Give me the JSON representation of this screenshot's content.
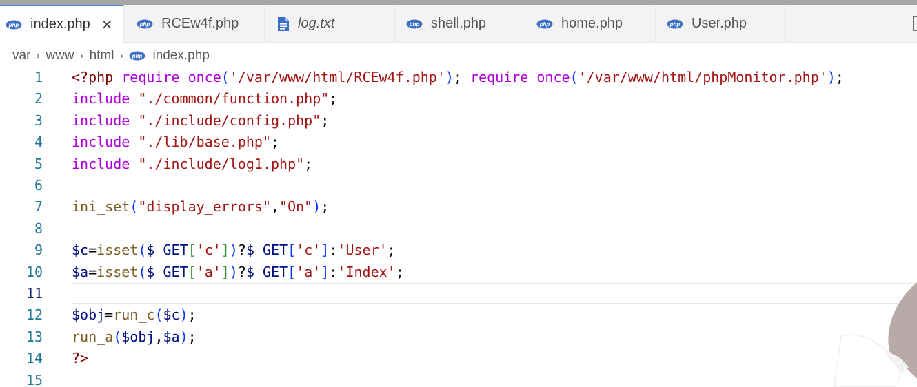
{
  "tabs": [
    {
      "label": "index.php",
      "icon": "php-icon",
      "active": true,
      "close": "✕"
    },
    {
      "label": "RCEw4f.php",
      "icon": "php-icon",
      "active": false
    },
    {
      "label": "log.txt",
      "icon": "file-text-icon",
      "active": false
    },
    {
      "label": "shell.php",
      "icon": "php-icon",
      "active": false
    },
    {
      "label": "home.php",
      "icon": "php-icon",
      "active": false
    },
    {
      "label": "User.php",
      "icon": "php-icon",
      "active": false
    }
  ],
  "breadcrumb": {
    "segments": [
      "var",
      "www",
      "html"
    ],
    "file": "index.php",
    "separator": "›"
  },
  "editor": {
    "active_line": 11,
    "lines": [
      {
        "n": "1",
        "tokens": [
          {
            "t": "<?php",
            "c": "tag"
          },
          {
            "t": " ",
            "c": "op"
          },
          {
            "t": "require_once",
            "c": "kw"
          },
          {
            "t": "(",
            "c": "p1"
          },
          {
            "t": "'/var/www/html/RCEw4f.php'",
            "c": "str"
          },
          {
            "t": ")",
            "c": "p1"
          },
          {
            "t": "; ",
            "c": "op"
          },
          {
            "t": "require_once",
            "c": "kw"
          },
          {
            "t": "(",
            "c": "p1"
          },
          {
            "t": "'/var/www/html/phpMonitor.php'",
            "c": "str"
          },
          {
            "t": ")",
            "c": "p1"
          },
          {
            "t": ";",
            "c": "op"
          }
        ]
      },
      {
        "n": "2",
        "tokens": [
          {
            "t": "include",
            "c": "kw"
          },
          {
            "t": " ",
            "c": "op"
          },
          {
            "t": "\"./common/function.php\"",
            "c": "str"
          },
          {
            "t": ";",
            "c": "op"
          }
        ]
      },
      {
        "n": "3",
        "tokens": [
          {
            "t": "include",
            "c": "kw"
          },
          {
            "t": " ",
            "c": "op"
          },
          {
            "t": "\"./include/config.php\"",
            "c": "str"
          },
          {
            "t": ";",
            "c": "op"
          }
        ]
      },
      {
        "n": "4",
        "tokens": [
          {
            "t": "include",
            "c": "kw"
          },
          {
            "t": " ",
            "c": "op"
          },
          {
            "t": "\"./lib/base.php\"",
            "c": "str"
          },
          {
            "t": ";",
            "c": "op"
          }
        ]
      },
      {
        "n": "5",
        "tokens": [
          {
            "t": "include",
            "c": "kw"
          },
          {
            "t": " ",
            "c": "op"
          },
          {
            "t": "\"./include/log1.php\"",
            "c": "str"
          },
          {
            "t": ";",
            "c": "op"
          }
        ]
      },
      {
        "n": "6",
        "tokens": []
      },
      {
        "n": "7",
        "tokens": [
          {
            "t": "ini_set",
            "c": "fn"
          },
          {
            "t": "(",
            "c": "p1"
          },
          {
            "t": "\"display_errors\"",
            "c": "str"
          },
          {
            "t": ",",
            "c": "op"
          },
          {
            "t": "\"On\"",
            "c": "str"
          },
          {
            "t": ")",
            "c": "p1"
          },
          {
            "t": ";",
            "c": "op"
          }
        ]
      },
      {
        "n": "8",
        "tokens": []
      },
      {
        "n": "9",
        "tokens": [
          {
            "t": "$c",
            "c": "var"
          },
          {
            "t": "=",
            "c": "op"
          },
          {
            "t": "isset",
            "c": "fn"
          },
          {
            "t": "(",
            "c": "p1"
          },
          {
            "t": "$_GET",
            "c": "var"
          },
          {
            "t": "[",
            "c": "p2"
          },
          {
            "t": "'c'",
            "c": "str"
          },
          {
            "t": "]",
            "c": "p2"
          },
          {
            "t": ")",
            "c": "p1"
          },
          {
            "t": "?",
            "c": "op"
          },
          {
            "t": "$_GET",
            "c": "var"
          },
          {
            "t": "[",
            "c": "p1"
          },
          {
            "t": "'c'",
            "c": "str"
          },
          {
            "t": "]",
            "c": "p1"
          },
          {
            "t": ":",
            "c": "op"
          },
          {
            "t": "'User'",
            "c": "str"
          },
          {
            "t": ";",
            "c": "op"
          }
        ]
      },
      {
        "n": "10",
        "tokens": [
          {
            "t": "$a",
            "c": "var"
          },
          {
            "t": "=",
            "c": "op"
          },
          {
            "t": "isset",
            "c": "fn"
          },
          {
            "t": "(",
            "c": "p1"
          },
          {
            "t": "$_GET",
            "c": "var"
          },
          {
            "t": "[",
            "c": "p2"
          },
          {
            "t": "'a'",
            "c": "str"
          },
          {
            "t": "]",
            "c": "p2"
          },
          {
            "t": ")",
            "c": "p1"
          },
          {
            "t": "?",
            "c": "op"
          },
          {
            "t": "$_GET",
            "c": "var"
          },
          {
            "t": "[",
            "c": "p1"
          },
          {
            "t": "'a'",
            "c": "str"
          },
          {
            "t": "]",
            "c": "p1"
          },
          {
            "t": ":",
            "c": "op"
          },
          {
            "t": "'Index'",
            "c": "str"
          },
          {
            "t": ";",
            "c": "op"
          }
        ]
      },
      {
        "n": "11",
        "tokens": []
      },
      {
        "n": "12",
        "tokens": [
          {
            "t": "$obj",
            "c": "var"
          },
          {
            "t": "=",
            "c": "op"
          },
          {
            "t": "run_c",
            "c": "fn"
          },
          {
            "t": "(",
            "c": "p1"
          },
          {
            "t": "$c",
            "c": "var"
          },
          {
            "t": ")",
            "c": "p1"
          },
          {
            "t": ";",
            "c": "op"
          }
        ]
      },
      {
        "n": "13",
        "tokens": [
          {
            "t": "run_a",
            "c": "fn"
          },
          {
            "t": "(",
            "c": "p1"
          },
          {
            "t": "$obj",
            "c": "var"
          },
          {
            "t": ",",
            "c": "op"
          },
          {
            "t": "$a",
            "c": "var"
          },
          {
            "t": ")",
            "c": "p1"
          },
          {
            "t": ";",
            "c": "op"
          }
        ]
      },
      {
        "n": "14",
        "tokens": [
          {
            "t": "?>",
            "c": "tag"
          }
        ]
      },
      {
        "n": "15",
        "tokens": []
      }
    ]
  },
  "colors": {
    "keyword": "#af00db",
    "string": "#a31515",
    "variable": "#001080",
    "function": "#795e26",
    "php_tag": "#800000",
    "line_number": "#237893",
    "php_icon": "#3c6fc4",
    "active_tab_border": "#4a8ad4"
  }
}
